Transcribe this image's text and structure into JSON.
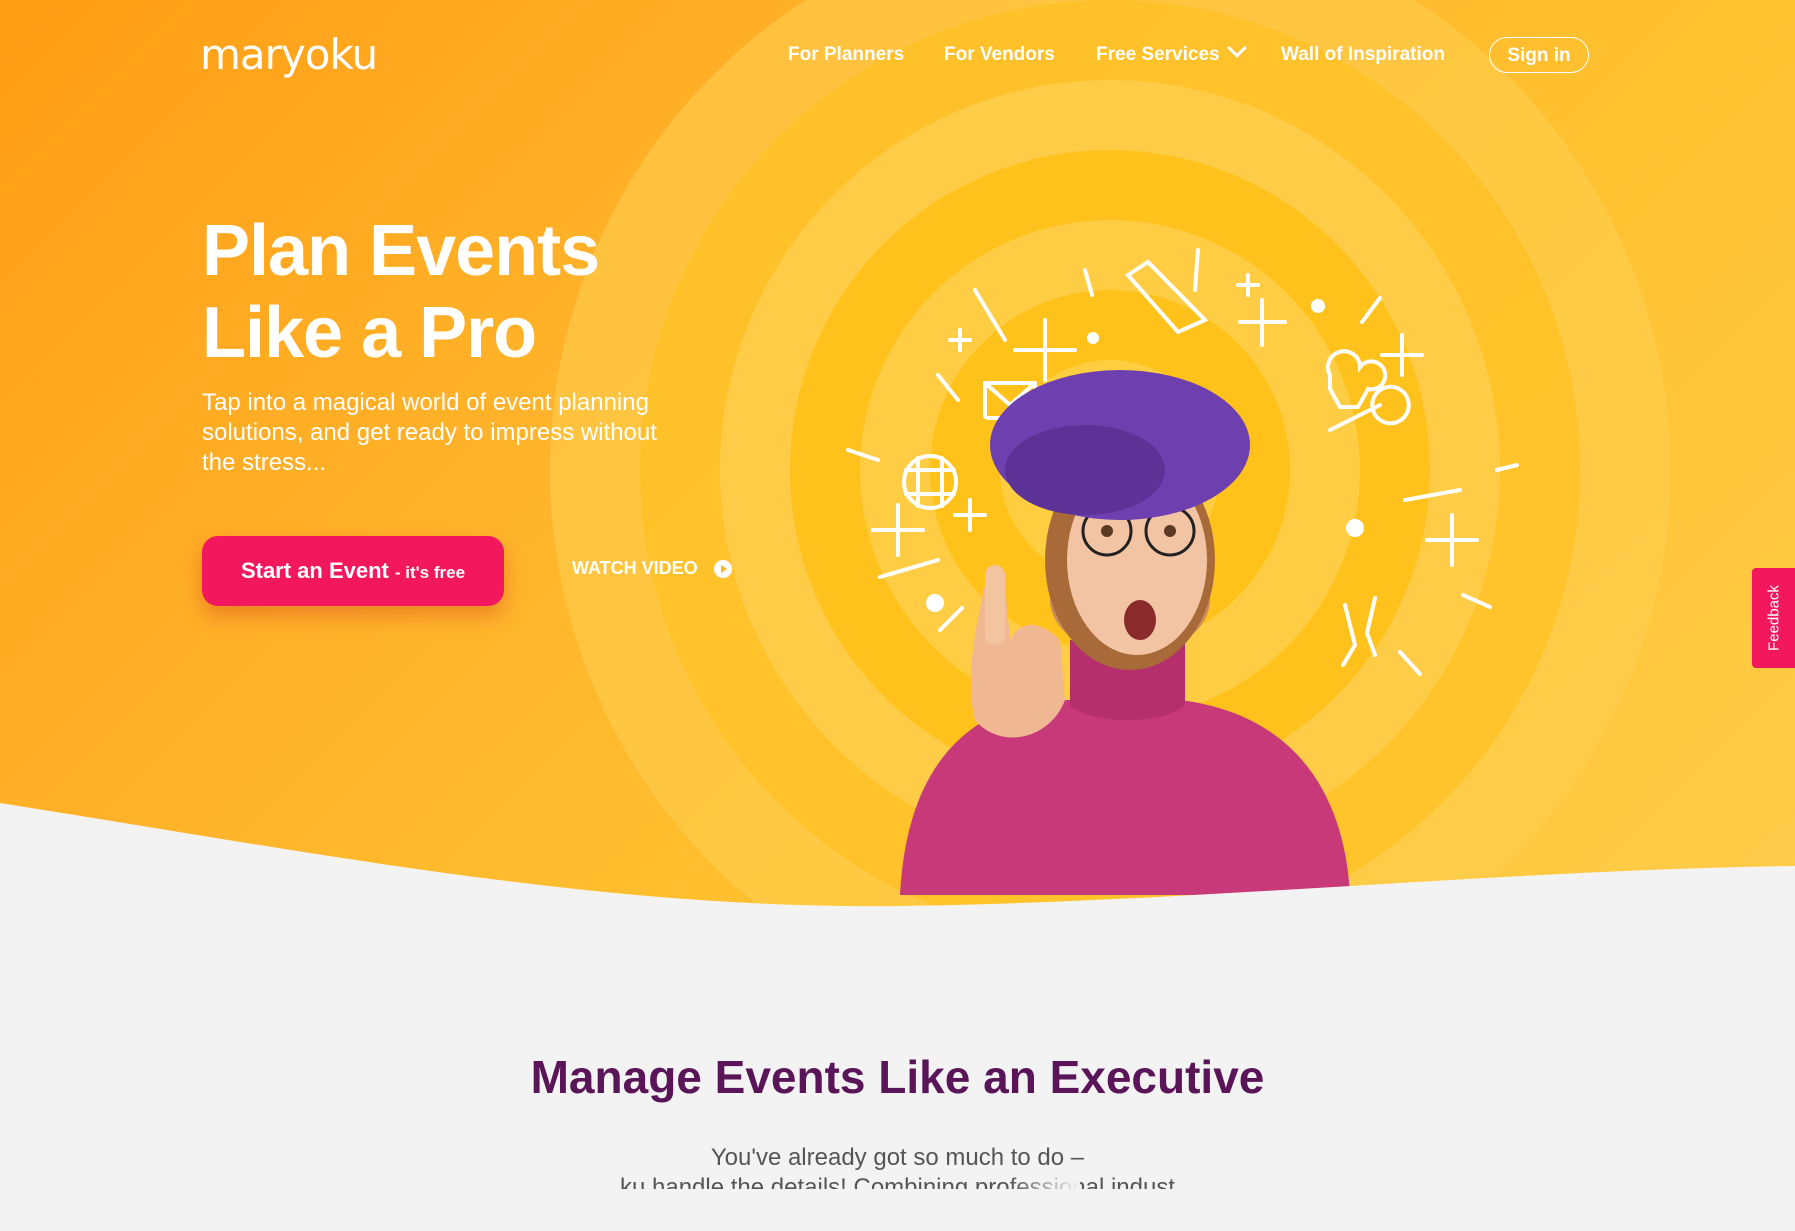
{
  "brand": {
    "logo_text": "maryoku",
    "accent_color": "#f3175e",
    "hero_color": "#ffb32a",
    "heading_color": "#5a1458"
  },
  "nav": {
    "items": [
      {
        "label": "For Planners"
      },
      {
        "label": "For Vendors"
      },
      {
        "label": "Free Services",
        "icon": "chevron-down-icon"
      },
      {
        "label": "Wall of Inspiration"
      }
    ],
    "signin_label": "Sign in"
  },
  "hero": {
    "title_line1": "Plan Events",
    "title_line2": "Like a Pro",
    "subtitle": "Tap into a magical world of event planning solutions, and get ready to impress without the stress...",
    "cta_main": "Start an Event",
    "cta_suffix": "- it's free",
    "watch_label": "WATCH VIDEO",
    "watch_icon": "play-circle-icon"
  },
  "feedback_tab": {
    "label": "Feedback"
  },
  "section": {
    "title": "Manage Events Like an Executive",
    "line1": "You've already got so much to do –",
    "line2": "...ku handle the details! Combining professional indust..."
  }
}
